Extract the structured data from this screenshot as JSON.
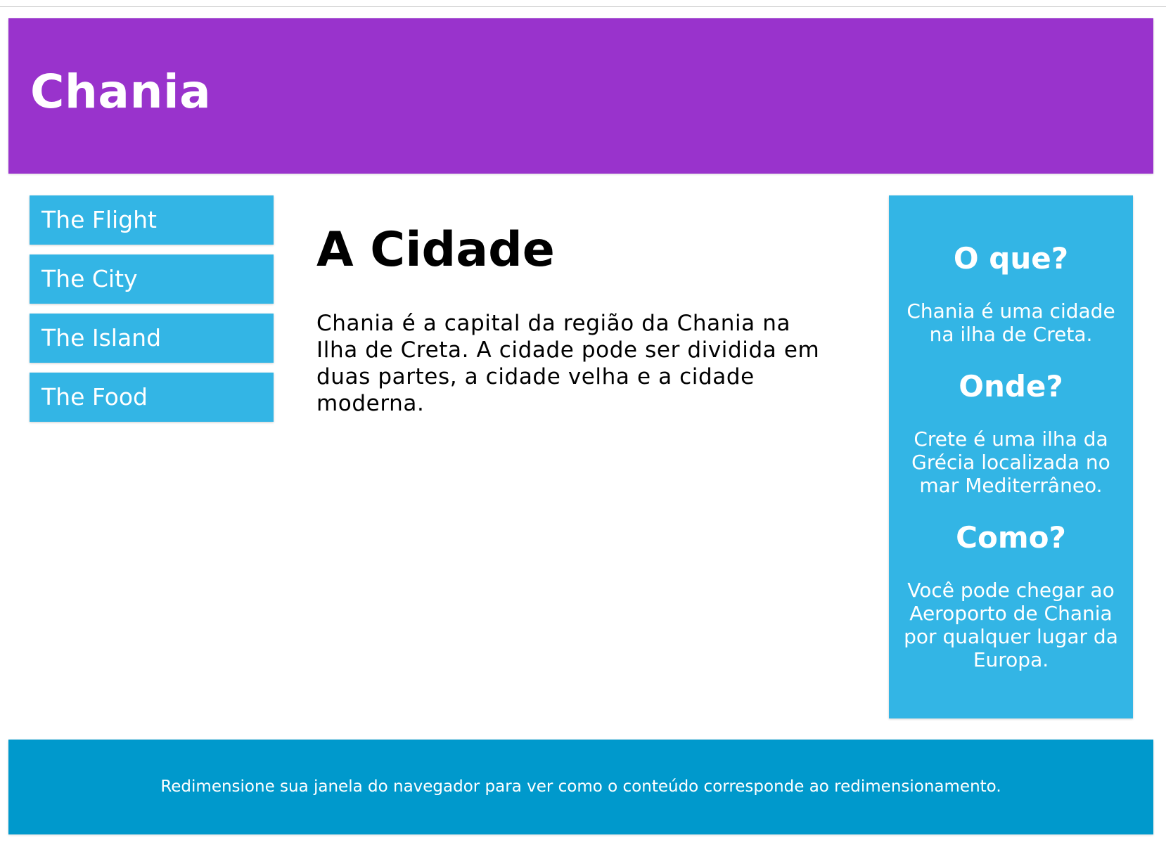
{
  "header": {
    "title": "Chania"
  },
  "menu": {
    "items": [
      {
        "label": "The Flight"
      },
      {
        "label": "The City"
      },
      {
        "label": "The Island"
      },
      {
        "label": "The Food"
      }
    ]
  },
  "main": {
    "heading": "A Cidade",
    "paragraph": "Chania é a capital da região da Chania na Ilha de Creta. A cidade pode ser dividida em duas partes, a cidade velha e a cidade moderna."
  },
  "aside": {
    "sections": [
      {
        "heading": "O que?",
        "text": "Chania é uma cidade na ilha de Creta."
      },
      {
        "heading": "Onde?",
        "text": "Crete é uma ilha da Grécia localizada no mar Mediterrâneo."
      },
      {
        "heading": "Como?",
        "text": "Você pode chegar ao Aeroporto de Chania por qualquer lugar da Europa."
      }
    ]
  },
  "footer": {
    "text": "Redimensione sua janela do navegador para ver como o conteúdo corresponde ao redimensionamento."
  },
  "colors": {
    "header": "#9933cc",
    "accent": "#33b5e5",
    "footer": "#0099cc"
  }
}
